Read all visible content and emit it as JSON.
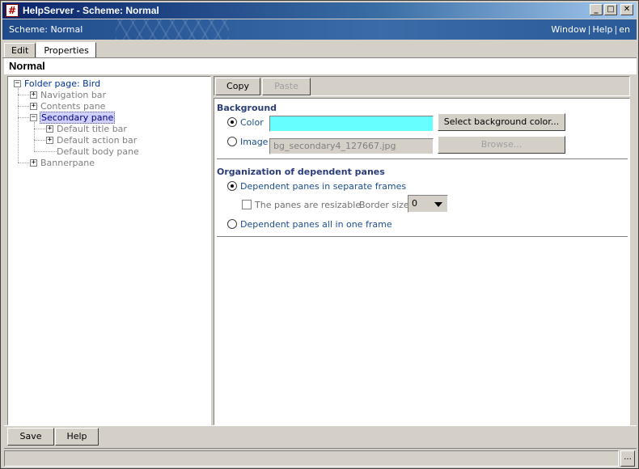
{
  "window": {
    "title": "HelpServer - Scheme: Normal",
    "app_icon": "#",
    "controls": {
      "minimize": "_",
      "maximize": "□",
      "close": "✕"
    }
  },
  "banner": {
    "scheme_label": "Scheme: Normal",
    "menu": [
      "Window",
      "Help",
      "en"
    ],
    "separator": "|"
  },
  "tabs": [
    {
      "label": "Edit",
      "active": false
    },
    {
      "label": "Properties",
      "active": true
    }
  ],
  "page": {
    "title": "Normal"
  },
  "tree": {
    "root": "Folder page: Bird",
    "items": [
      "Navigation bar",
      "Contents pane",
      "Secondary pane",
      "Default title bar",
      "Default action bar",
      "Default body pane",
      "Bannerpane"
    ],
    "expanded_sign": "−",
    "collapsed_sign": "+"
  },
  "toolbar": {
    "copy": "Copy",
    "paste": "Paste"
  },
  "background": {
    "section": "Background",
    "color_label": "Color",
    "color_value": "#66ffff",
    "select_color_button": "Select background color...",
    "image_label": "Image",
    "image_value": "bg_secondary4_127667.jpg",
    "browse_button": "Browse..."
  },
  "organization": {
    "section": "Organization of dependent panes",
    "option_separate": "Dependent panes in separate frames",
    "resizable_label": "The panes are resizable",
    "border_size_label": "Border size",
    "border_size_value": "0",
    "option_one_frame": "Dependent panes all in one frame"
  },
  "footer": {
    "save": "Save",
    "help": "Help",
    "status_button": "..."
  }
}
